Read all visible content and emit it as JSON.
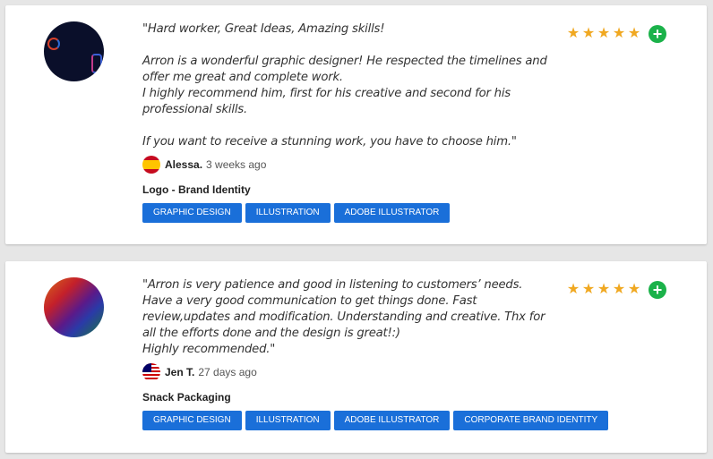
{
  "reviews": [
    {
      "text": "\"Hard worker, Great Ideas, Amazing skills!\n\nArron is a wonderful graphic designer! He respected the timelines and offer me great and complete work.\nI highly recommend him, first for his creative and second for his professional skills.\n\nIf you want to receive a stunning work, you have to choose him.\"",
      "author": "Alessa.",
      "time": "3 weeks ago",
      "project": "Logo - Brand Identity",
      "tags": [
        "GRAPHIC DESIGN",
        "ILLUSTRATION",
        "ADOBE ILLUSTRATOR"
      ],
      "rating": 5
    },
    {
      "text": "\"Arron is very patience and good in listening to customers’ needs. Have a very good communication to get things done. Fast review,updates and modification. Understanding and creative. Thx for all the efforts done and the design is great!:)\nHighly recommended.\"",
      "author": "Jen T.",
      "time": "27 days ago",
      "project": "Snack Packaging",
      "tags": [
        "GRAPHIC DESIGN",
        "ILLUSTRATION",
        "ADOBE ILLUSTRATOR",
        "CORPORATE BRAND IDENTITY"
      ],
      "rating": 5
    }
  ],
  "icons": {
    "star": "★",
    "plus": "+"
  },
  "colors": {
    "tag": "#1a6fd9",
    "star": "#f0a821",
    "plus": "#1bb24a"
  }
}
